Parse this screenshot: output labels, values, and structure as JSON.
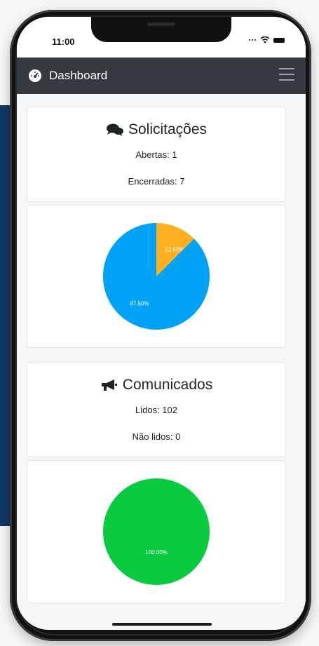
{
  "status_bar": {
    "time": "11:00"
  },
  "header": {
    "title": "Dashboard"
  },
  "solicitacoes": {
    "title": "Solicitações",
    "abertas": "Abertas: 1",
    "encerradas": "Encerradas: 7"
  },
  "comunicados": {
    "title": "Comunicados",
    "lidos": "Lidos: 102",
    "nao_lidos": "Não lidos: 0"
  },
  "chart_data": [
    {
      "type": "pie",
      "slices": [
        {
          "value": 12.5,
          "label": "12.50%",
          "color": "#ffb020"
        },
        {
          "value": 87.5,
          "label": "87.50%",
          "color": "#00a2f5"
        }
      ]
    },
    {
      "type": "pie",
      "slices": [
        {
          "value": 100,
          "label": "100.00%",
          "color": "#0acb3f"
        }
      ]
    }
  ],
  "colors": {
    "appbar": "#343a40",
    "background_accent": "#0f3868"
  }
}
